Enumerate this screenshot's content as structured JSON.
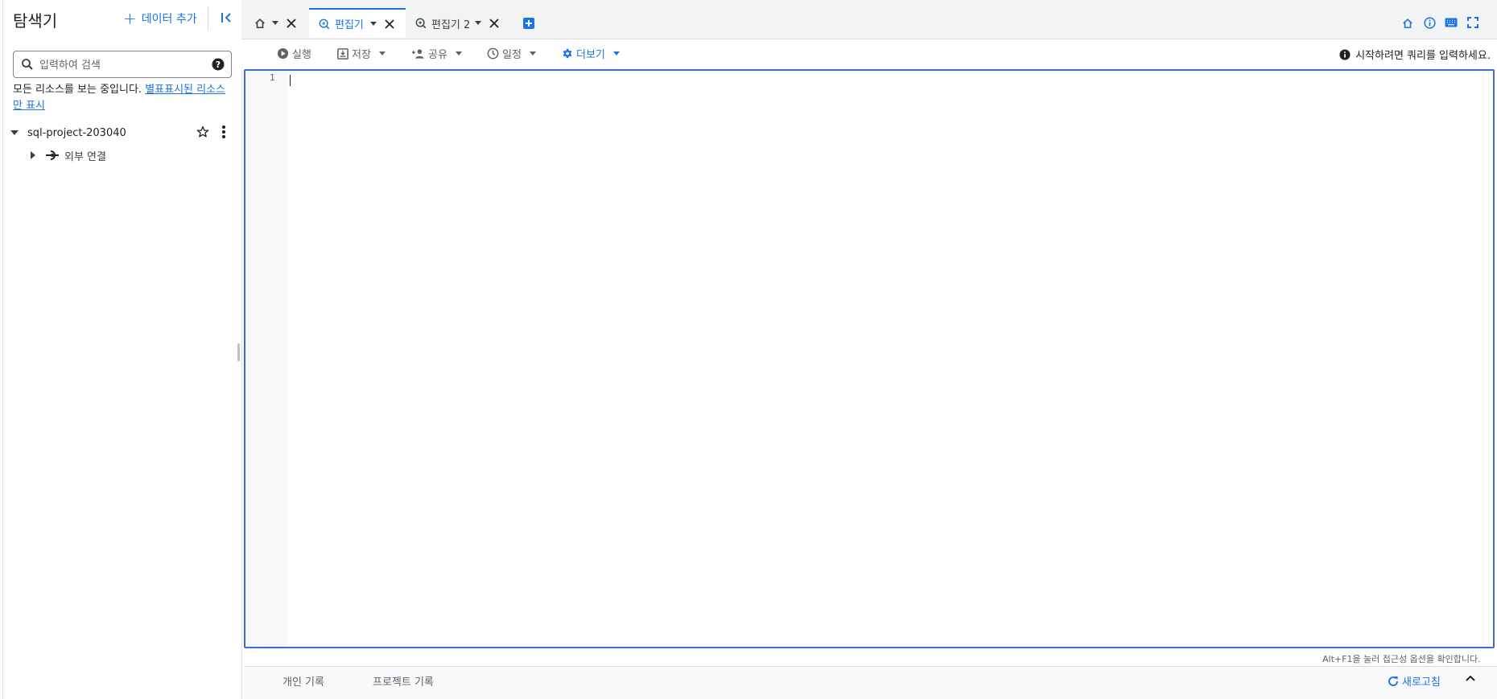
{
  "explorer": {
    "title": "탐색기",
    "add_data_label": "데이터 추가",
    "search_placeholder": "입력하여 검색",
    "resource_note_prefix": "모든 리소스를 보는 중입니다. ",
    "resource_note_link": "별표표시된 리소스만 표시",
    "project": "sql-project-203040",
    "child": "외부 연결"
  },
  "tabs": [
    {
      "label": "",
      "icon": "home-icon"
    },
    {
      "label": "편집기",
      "icon": "query-icon",
      "active": true
    },
    {
      "label": "편집기 2",
      "icon": "query-icon"
    }
  ],
  "toolbar": {
    "run": "실행",
    "save": "저장",
    "share": "공유",
    "schedule": "일정",
    "more": "더보기",
    "hint": "시작하려면 쿼리를 입력하세요."
  },
  "editor": {
    "line_number": "1",
    "accessibility_hint": "Alt+F1을 눌러 접근성 옵션을 확인합니다."
  },
  "bottom": {
    "personal_history": "개인 기록",
    "project_history": "프로젝트 기록",
    "refresh": "새로고침"
  },
  "colors": {
    "accent": "#1a73e8",
    "editor_border": "#3b6fc4"
  }
}
